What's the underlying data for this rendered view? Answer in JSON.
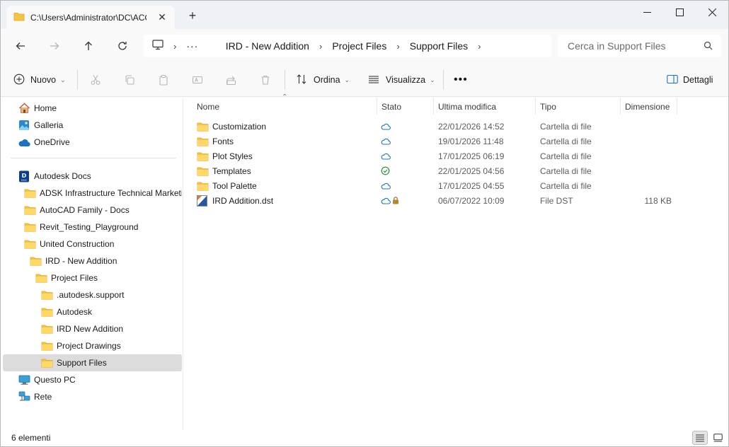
{
  "tab": {
    "title": "C:\\Users\\Administrator\\DC\\ACC"
  },
  "breadcrumb": [
    "IRD - New Addition",
    "Project Files",
    "Support Files"
  ],
  "search": {
    "placeholder": "Cerca in Support Files"
  },
  "toolbar": {
    "new_label": "Nuovo",
    "sort_label": "Ordina",
    "view_label": "Visualizza",
    "details_label": "Dettagli"
  },
  "sidebar": {
    "items": [
      {
        "label": "Home",
        "icon": "home-icon",
        "level": 0
      },
      {
        "label": "Galleria",
        "icon": "gallery-icon",
        "level": 0
      },
      {
        "label": "OneDrive",
        "icon": "onedrive-icon",
        "level": 0
      },
      {
        "label": "Autodesk Docs",
        "icon": "autodesk-docs-icon",
        "level": 0
      },
      {
        "label": "ADSK Infrastructure Technical Marketing",
        "icon": "folder-icon",
        "level": 1
      },
      {
        "label": "AutoCAD Family - Docs",
        "icon": "folder-icon",
        "level": 1
      },
      {
        "label": "Revit_Testing_Playground",
        "icon": "folder-icon",
        "level": 1
      },
      {
        "label": "United Construction",
        "icon": "folder-icon",
        "level": 1
      },
      {
        "label": "IRD - New Addition",
        "icon": "folder-icon",
        "level": 2
      },
      {
        "label": "Project Files",
        "icon": "folder-icon",
        "level": 3
      },
      {
        "label": ".autodesk.support",
        "icon": "folder-icon",
        "level": 4
      },
      {
        "label": "Autodesk",
        "icon": "folder-icon",
        "level": 4
      },
      {
        "label": "IRD New Addition",
        "icon": "folder-icon",
        "level": 4
      },
      {
        "label": "Project Drawings",
        "icon": "folder-icon",
        "level": 4
      },
      {
        "label": "Support Files",
        "icon": "folder-icon",
        "level": 4,
        "selected": true
      },
      {
        "label": "Questo PC",
        "icon": "this-pc-icon",
        "level": 0
      },
      {
        "label": "Rete",
        "icon": "network-icon",
        "level": 0
      }
    ]
  },
  "columns": {
    "name": "Nome",
    "status": "Stato",
    "modified": "Ultima modifica",
    "type": "Tipo",
    "size": "Dimensione"
  },
  "files": [
    {
      "name": "Customization",
      "icon": "folder-icon",
      "status": "cloud",
      "modified": "22/01/2026 14:52",
      "type": "Cartella di file",
      "size": ""
    },
    {
      "name": "Fonts",
      "icon": "folder-icon",
      "status": "cloud",
      "modified": "19/01/2026 11:48",
      "type": "Cartella di file",
      "size": ""
    },
    {
      "name": "Plot Styles",
      "icon": "folder-icon",
      "status": "cloud",
      "modified": "17/01/2025 06:19",
      "type": "Cartella di file",
      "size": ""
    },
    {
      "name": "Templates",
      "icon": "folder-icon",
      "status": "synced",
      "modified": "22/01/2025 04:56",
      "type": "Cartella di file",
      "size": ""
    },
    {
      "name": "Tool Palette",
      "icon": "folder-icon",
      "status": "cloud",
      "modified": "17/01/2025 04:55",
      "type": "Cartella di file",
      "size": ""
    },
    {
      "name": "IRD Addition.dst",
      "icon": "dst-file-icon",
      "status": "cloud-locked",
      "modified": "06/07/2022 10:09",
      "type": "File DST",
      "size": "118 KB"
    }
  ],
  "status_bar": {
    "item_count": "6 elementi"
  },
  "colors": {
    "folder": "#f4c542",
    "cloud": "#1a73c8",
    "synced": "#2e8b3a",
    "selected": "#dcdcdc"
  }
}
